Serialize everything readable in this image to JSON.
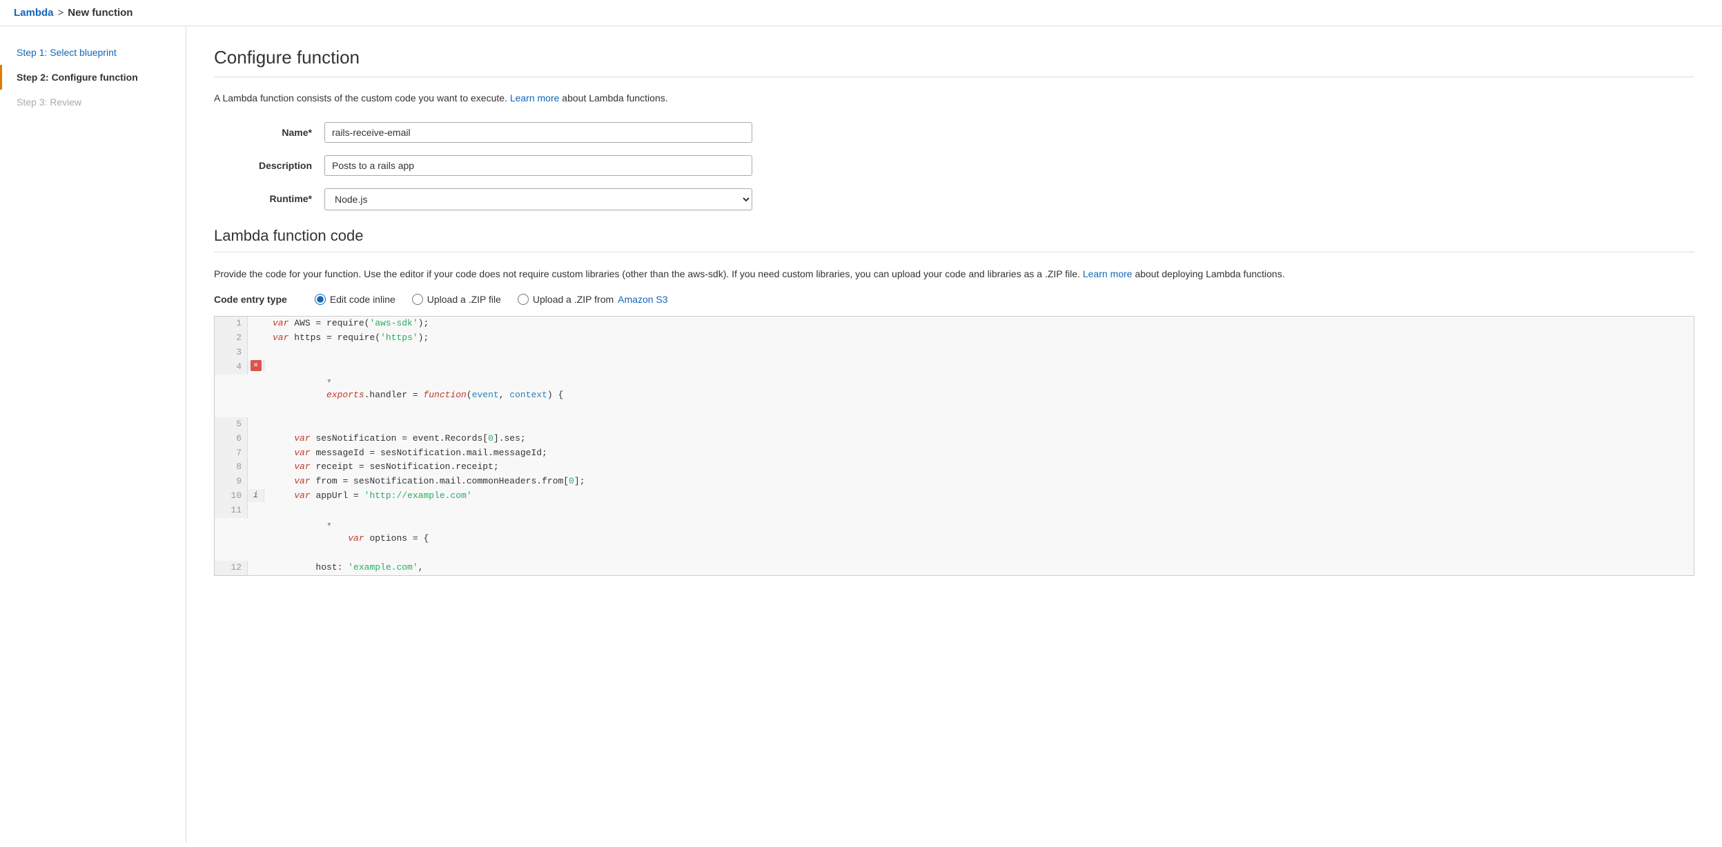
{
  "breadcrumb": {
    "lambda_link": "Lambda",
    "separator": ">",
    "current": "New function"
  },
  "sidebar": {
    "items": [
      {
        "id": "step1",
        "label": "Step 1: Select blueprint",
        "type": "link"
      },
      {
        "id": "step2",
        "label": "Step 2: Configure function",
        "type": "active"
      },
      {
        "id": "step3",
        "label": "Step 3: Review",
        "type": "disabled"
      }
    ]
  },
  "main": {
    "page_title": "Configure function",
    "intro_text": "A Lambda function consists of the custom code you want to execute.",
    "learn_more_text": "Learn more",
    "intro_suffix": " about Lambda functions.",
    "fields": {
      "name": {
        "label": "Name*",
        "value": "rails-receive-email"
      },
      "description": {
        "label": "Description",
        "value": "Posts to a rails app"
      },
      "runtime": {
        "label": "Runtime*",
        "value": "Node.js"
      }
    },
    "code_section": {
      "title": "Lambda function code",
      "description_part1": "Provide the code for your function. Use the editor if your code does not require custom libraries (other than the aws-sdk). If you need custom libraries, you can upload your code and libraries as a .ZIP file.",
      "learn_more_text": "Learn more",
      "description_part2": " about deploying Lambda functions.",
      "code_entry_type": {
        "label": "Code entry type",
        "options": [
          {
            "id": "inline",
            "label": "Edit code inline",
            "selected": true
          },
          {
            "id": "zip",
            "label": "Upload a .ZIP file",
            "selected": false
          },
          {
            "id": "s3",
            "label": "Upload a .ZIP from ",
            "link": "Amazon S3",
            "selected": false
          }
        ]
      },
      "code_lines": [
        {
          "num": 1,
          "gutter": "",
          "content": "var AWS = require('aws-sdk');"
        },
        {
          "num": 2,
          "gutter": "",
          "content": "var https = require('https');"
        },
        {
          "num": 3,
          "gutter": "",
          "content": ""
        },
        {
          "num": 4,
          "gutter": "error",
          "content": "exports.handler = function(event, context) {",
          "fold": true
        },
        {
          "num": 5,
          "gutter": "",
          "content": ""
        },
        {
          "num": 6,
          "gutter": "",
          "content": "    var sesNotification = event.Records[0].ses;"
        },
        {
          "num": 7,
          "gutter": "",
          "content": "    var messageId = sesNotification.mail.messageId;"
        },
        {
          "num": 8,
          "gutter": "",
          "content": "    var receipt = sesNotification.receipt;"
        },
        {
          "num": 9,
          "gutter": "",
          "content": "    var from = sesNotification.mail.commonHeaders.from[0];"
        },
        {
          "num": 10,
          "gutter": "info",
          "content": "    var appUrl = 'http://example.com'"
        },
        {
          "num": 11,
          "gutter": "",
          "content": "    var options = {",
          "fold": true
        },
        {
          "num": 12,
          "gutter": "",
          "content": "        host: 'example.com',"
        }
      ]
    }
  }
}
